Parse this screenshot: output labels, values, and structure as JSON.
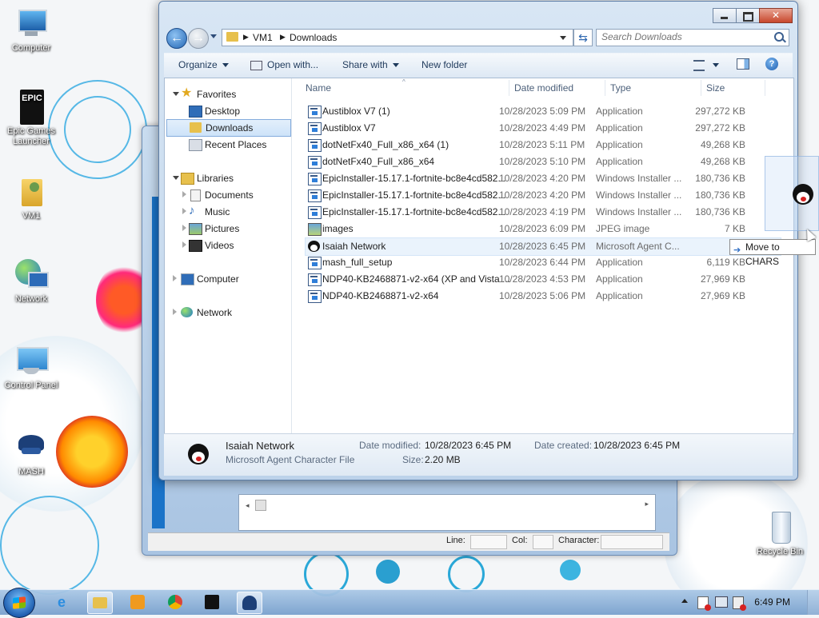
{
  "desktop": {
    "icons": [
      {
        "label": "Computer"
      },
      {
        "label": "Epic Games Launcher"
      },
      {
        "label": "VM1"
      },
      {
        "label": "Network"
      },
      {
        "label": "Control Panel"
      },
      {
        "label": "MASH"
      },
      {
        "label": "Recycle Bin"
      }
    ]
  },
  "background_window": {
    "status": {
      "line_label": "Line:",
      "col_label": "Col:",
      "char_label": "Character:"
    }
  },
  "explorer": {
    "breadcrumb": [
      "VM1",
      "Downloads"
    ],
    "search_placeholder": "Search Downloads",
    "toolbar": {
      "organize": "Organize",
      "open_with": "Open with...",
      "share_with": "Share with",
      "new_folder": "New folder"
    },
    "nav": {
      "favorites": "Favorites",
      "desktop": "Desktop",
      "downloads": "Downloads",
      "recent_places": "Recent Places",
      "libraries": "Libraries",
      "documents": "Documents",
      "music": "Music",
      "pictures": "Pictures",
      "videos": "Videos",
      "computer": "Computer",
      "network": "Network"
    },
    "columns": {
      "name": "Name",
      "date": "Date modified",
      "type": "Type",
      "size": "Size"
    },
    "files": [
      {
        "name": "Austiblox V7 (1)",
        "date": "10/28/2023 5:09 PM",
        "type": "Application",
        "size": "297,272 KB",
        "icon": "app-icon"
      },
      {
        "name": "Austiblox V7",
        "date": "10/28/2023 4:49 PM",
        "type": "Application",
        "size": "297,272 KB",
        "icon": "app-icon"
      },
      {
        "name": "dotNetFx40_Full_x86_x64 (1)",
        "date": "10/28/2023 5:11 PM",
        "type": "Application",
        "size": "49,268 KB",
        "icon": "app-icon"
      },
      {
        "name": "dotNetFx40_Full_x86_x64",
        "date": "10/28/2023 5:10 PM",
        "type": "Application",
        "size": "49,268 KB",
        "icon": "app-icon"
      },
      {
        "name": "EpicInstaller-15.17.1-fortnite-bc8e4cd582...",
        "date": "10/28/2023 4:20 PM",
        "type": "Windows Installer ...",
        "size": "180,736 KB",
        "icon": "installer-icon"
      },
      {
        "name": "EpicInstaller-15.17.1-fortnite-bc8e4cd582...",
        "date": "10/28/2023 4:20 PM",
        "type": "Windows Installer ...",
        "size": "180,736 KB",
        "icon": "installer-icon"
      },
      {
        "name": "EpicInstaller-15.17.1-fortnite-bc8e4cd582...",
        "date": "10/28/2023 4:19 PM",
        "type": "Windows Installer ...",
        "size": "180,736 KB",
        "icon": "installer-icon"
      },
      {
        "name": "images",
        "date": "10/28/2023 6:09 PM",
        "type": "JPEG image",
        "size": "7 KB",
        "icon": "image-icon"
      },
      {
        "name": "Isaiah Network",
        "date": "10/28/2023 6:45 PM",
        "type": "Microsoft Agent C...",
        "size": "2",
        "icon": "agent-character-icon"
      },
      {
        "name": "mash_full_setup",
        "date": "10/28/2023 6:44 PM",
        "type": "Application",
        "size": "6,119 KB",
        "icon": "app-icon"
      },
      {
        "name": "NDP40-KB2468871-v2-x64 (XP and Vista ...",
        "date": "10/28/2023 4:53 PM",
        "type": "Application",
        "size": "27,969 KB",
        "icon": "app-icon"
      },
      {
        "name": "NDP40-KB2468871-v2-x64",
        "date": "10/28/2023 5:06 PM",
        "type": "Application",
        "size": "27,969 KB",
        "icon": "app-icon"
      }
    ],
    "details": {
      "name": "Isaiah Network",
      "type": "Microsoft Agent Character File",
      "modified_label": "Date modified:",
      "modified": "10/28/2023 6:45 PM",
      "created_label": "Date created:",
      "created": "10/28/2023 6:45 PM",
      "size_label": "Size:",
      "size": "2.20 MB"
    },
    "drag_tooltip": "Move to CHARS"
  },
  "taskbar": {
    "clock": "6:49 PM",
    "items": [
      "internet-explorer-icon",
      "file-explorer-icon",
      "media-player-icon",
      "chrome-icon",
      "epic-games-icon",
      "mash-icon"
    ]
  }
}
